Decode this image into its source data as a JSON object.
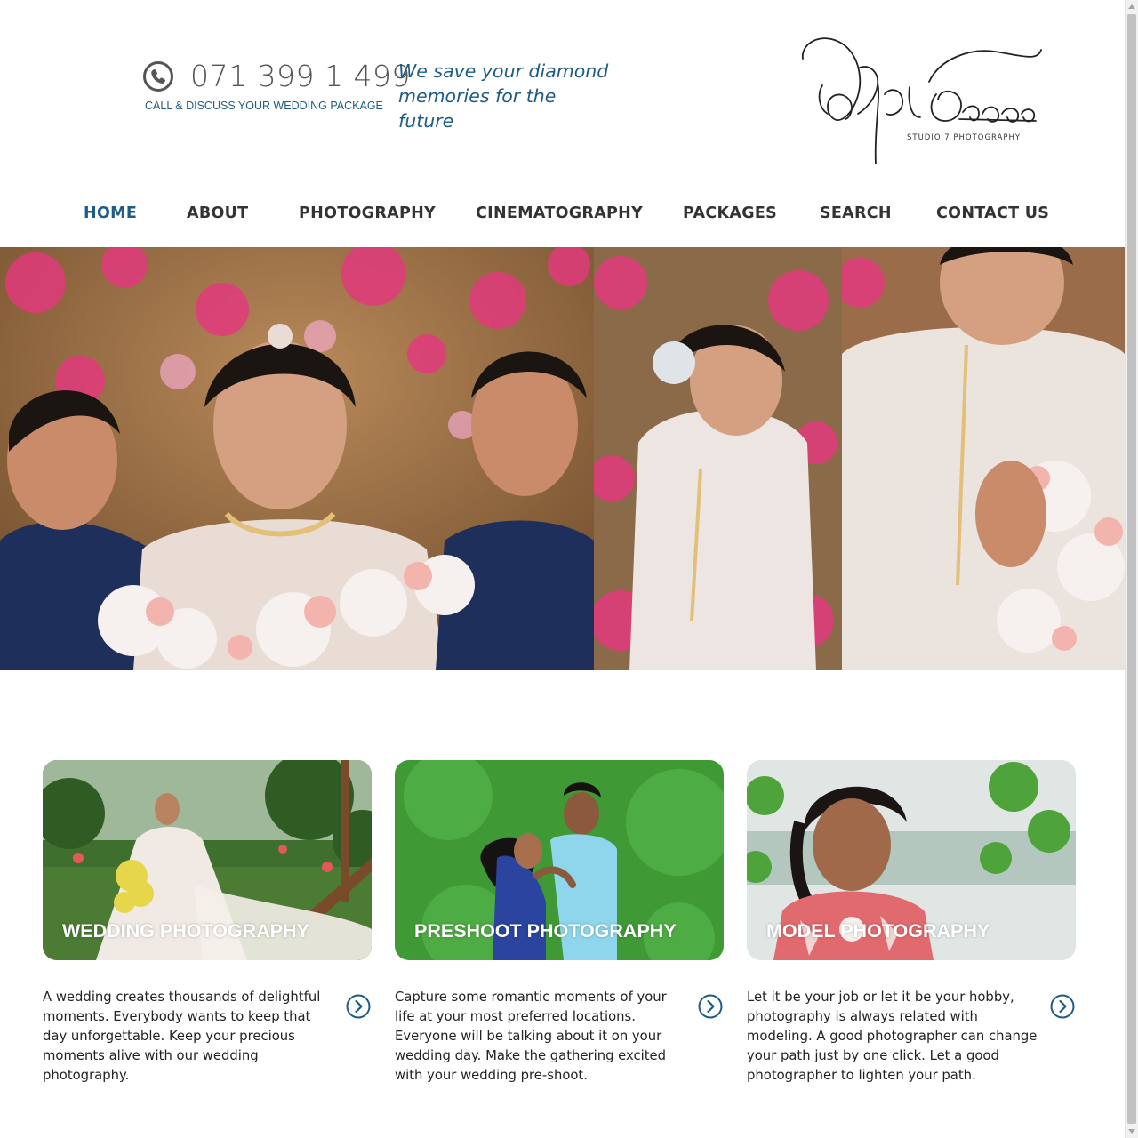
{
  "header": {
    "phone_number": "071 399 1 499",
    "phone_caption": "CALL & DISCUSS YOUR WEDDING PACKAGE",
    "tagline_line1": "We save your diamond",
    "tagline_line2": "memories for the future",
    "logo_subtitle": "STUDIO 7 PHOTOGRAPHY",
    "accent_color": "#1e5b86"
  },
  "nav": {
    "items": [
      {
        "label": "HOME",
        "active": true
      },
      {
        "label": "ABOUT"
      },
      {
        "label": "PHOTOGRAPHY"
      },
      {
        "label": "CINEMATOGRAPHY"
      },
      {
        "label": "PACKAGES"
      },
      {
        "label": "SEARCH"
      },
      {
        "label": "CONTACT US"
      }
    ]
  },
  "cards": [
    {
      "title": "WEDDING PHOTOGRAPHY",
      "text": "A wedding creates thousands of delightful moments. Everybody wants to keep that day unforgettable. Keep your precious moments alive with our wedding photography."
    },
    {
      "title": "PRESHOOT PHOTOGRAPHY",
      "text": "Capture some romantic moments of your life at your most preferred locations. Everyone will be talking about it on your wedding day. Make the gathering excited with your wedding pre-shoot."
    },
    {
      "title": "MODEL PHOTOGRAPHY",
      "text": "Let it be your job or let it be your hobby, photography is always related with modeling. A good photographer can change your path just by one click. Let a good photographer to lighten your path."
    }
  ],
  "icons": {
    "phone": "phone-icon",
    "arrow": "chevron-right-circle-icon"
  }
}
